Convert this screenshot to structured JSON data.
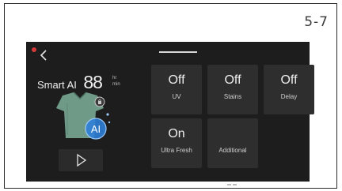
{
  "page": {
    "number": "5-7"
  },
  "panel": {
    "program_name": "Smart AI",
    "time_value": "88",
    "time_unit_top": "hr",
    "time_unit_bottom": "min",
    "ai_badge": "AI"
  },
  "tiles": [
    {
      "value": "Off",
      "label": "UV"
    },
    {
      "value": "Off",
      "label": "Stains"
    },
    {
      "value": "Off",
      "label": "Delay"
    },
    {
      "value": "On",
      "label": "Ultra Fresh"
    },
    {
      "value": "",
      "label": "Additional"
    }
  ],
  "colors": {
    "screen_background": "#1d1d1d",
    "tile_background": "#2e2e2e",
    "indicator": "#d43a3a",
    "ai_badge": "#2f7fd8",
    "shirt": "#6f9a88"
  },
  "icons": {
    "back": "chevron-left-icon",
    "play": "play-icon",
    "lock": "lock-icon"
  }
}
